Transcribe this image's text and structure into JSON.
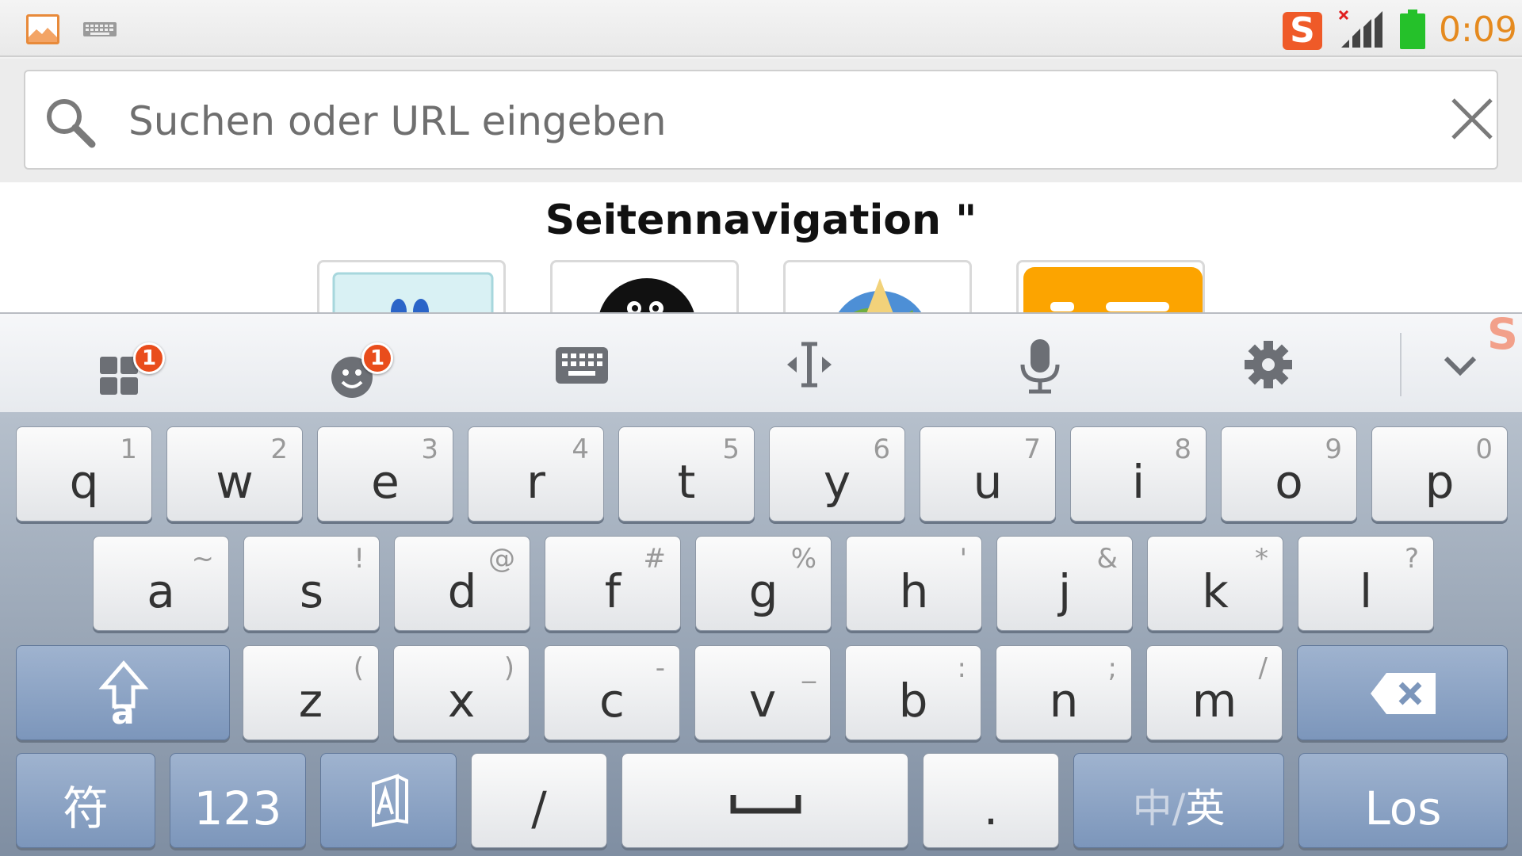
{
  "status_bar": {
    "time": "0:09"
  },
  "url_bar": {
    "placeholder": "Suchen oder URL eingeben"
  },
  "page": {
    "title": "Seitennavigation \""
  },
  "keyboard": {
    "row1": [
      {
        "char": "q",
        "alt": "1"
      },
      {
        "char": "w",
        "alt": "2"
      },
      {
        "char": "e",
        "alt": "3"
      },
      {
        "char": "r",
        "alt": "4"
      },
      {
        "char": "t",
        "alt": "5"
      },
      {
        "char": "y",
        "alt": "6"
      },
      {
        "char": "u",
        "alt": "7"
      },
      {
        "char": "i",
        "alt": "8"
      },
      {
        "char": "o",
        "alt": "9"
      },
      {
        "char": "p",
        "alt": "0"
      }
    ],
    "row2": [
      {
        "char": "a",
        "alt": "~"
      },
      {
        "char": "s",
        "alt": "!"
      },
      {
        "char": "d",
        "alt": "@"
      },
      {
        "char": "f",
        "alt": "#"
      },
      {
        "char": "g",
        "alt": "%"
      },
      {
        "char": "h",
        "alt": "'"
      },
      {
        "char": "j",
        "alt": "&"
      },
      {
        "char": "k",
        "alt": "*"
      },
      {
        "char": "l",
        "alt": "?"
      }
    ],
    "row3": [
      {
        "char": "z",
        "alt": "("
      },
      {
        "char": "x",
        "alt": ")"
      },
      {
        "char": "c",
        "alt": "-"
      },
      {
        "char": "v",
        "alt": "_"
      },
      {
        "char": "b",
        "alt": ":"
      },
      {
        "char": "n",
        "alt": ";"
      },
      {
        "char": "m",
        "alt": "/"
      }
    ],
    "shift_sub": "a",
    "symbols_label": "符",
    "numbers_label": "123",
    "slash_label": "/",
    "period_label": ".",
    "lang_zh": "中",
    "lang_sep": "/",
    "lang_en": "英",
    "enter_label": "Los",
    "toolbar_badge_1": "1",
    "toolbar_badge_2": "1",
    "sogou_letter": "S",
    "sogou_float": "S"
  },
  "icons": [
    "gallery-icon",
    "keyboard-icon",
    "sogou-icon",
    "signal-icon",
    "battery-icon",
    "search-icon",
    "close-icon",
    "grid-icon",
    "emoji-icon",
    "cursor-icon",
    "microphone-icon",
    "gear-icon",
    "chevron-down-icon",
    "shift-icon",
    "backspace-icon",
    "space-icon"
  ],
  "colors": {
    "accent_time": "#e58a1f",
    "battery": "#25c12a",
    "badge": "#e94d1c",
    "sogou": "#ef5a28"
  }
}
